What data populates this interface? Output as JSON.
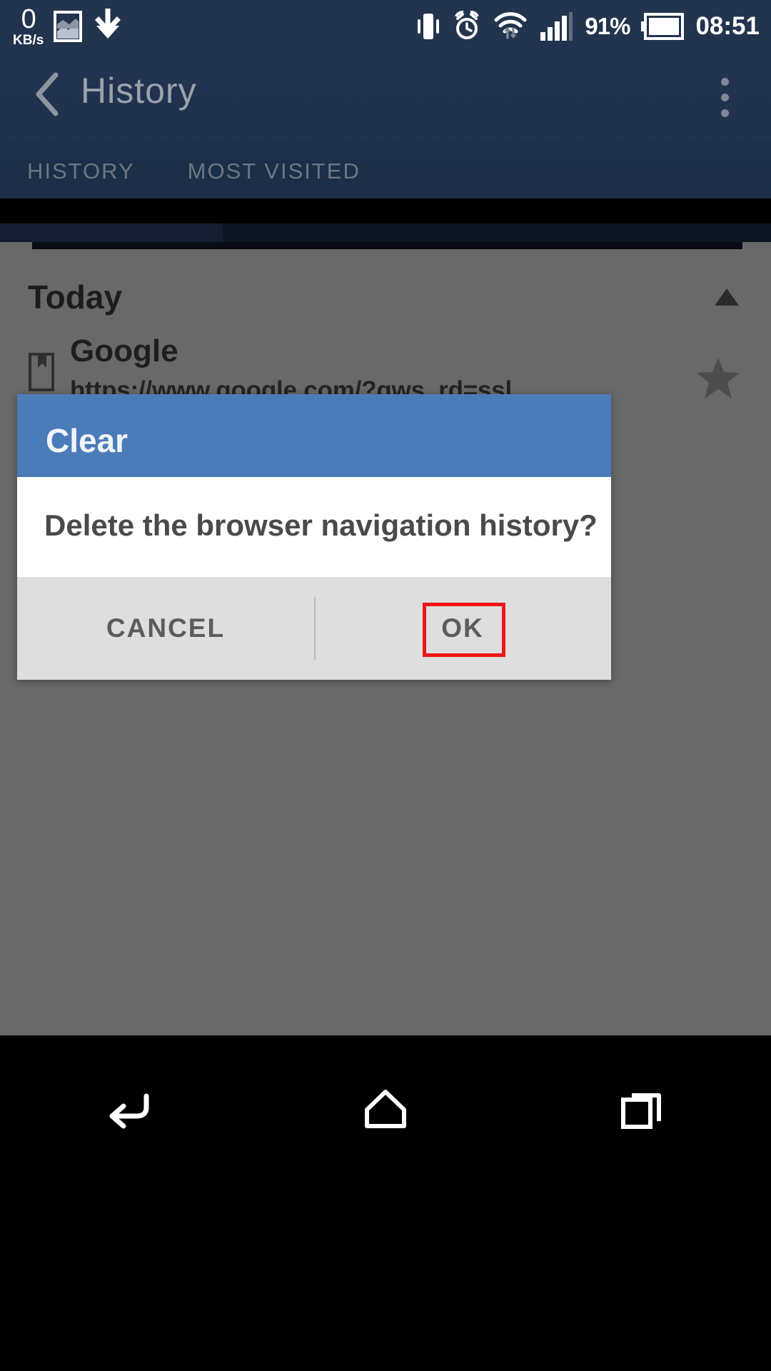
{
  "status_bar": {
    "network_speed_value": "0",
    "network_speed_unit": "KB/s",
    "icons": [
      "image-icon",
      "download-icon",
      "vibrate-icon",
      "alarm-icon",
      "wifi-icon",
      "signal-icon"
    ],
    "battery_percent": "91%",
    "battery_icon": "battery-icon",
    "clock": "08:51"
  },
  "app_bar": {
    "back_icon": "back-chevron-icon",
    "title": "History",
    "overflow_icon": "overflow-menu-icon"
  },
  "tabs": [
    {
      "label": "HISTORY",
      "selected": true
    },
    {
      "label": "MOST VISITED",
      "selected": false
    }
  ],
  "content": {
    "section": {
      "label": "Today",
      "collapse_icon": "triangle-up-icon"
    },
    "items": [
      {
        "icon": "bookmark-page-icon",
        "title": "Google",
        "url": "https://www.google.com/?gws_rd=ssl",
        "star_icon": "star-filled-icon"
      }
    ]
  },
  "dialog": {
    "title": "Clear",
    "message": "Delete the browser navigation history?",
    "cancel_label": "CANCEL",
    "ok_label": "OK",
    "header_color": "#4a7cba",
    "button_bar_color": "#dedede",
    "highlight_color": "#f01616"
  },
  "nav_bar": {
    "back_icon": "nav-back-icon",
    "home_icon": "nav-home-icon",
    "recents_icon": "nav-recents-icon"
  }
}
